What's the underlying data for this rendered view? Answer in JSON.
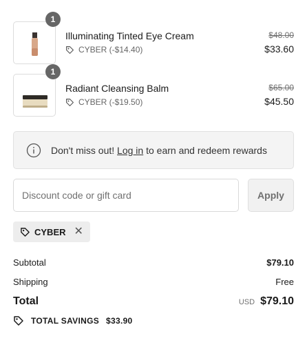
{
  "items": [
    {
      "quantity": "1",
      "name": "Illuminating Tinted Eye Cream",
      "discount": "CYBER (-$14.40)",
      "original_price": "$48.00",
      "price": "$33.60",
      "image": "bottle-thumbnail"
    },
    {
      "quantity": "1",
      "name": "Radiant Cleansing Balm",
      "discount": "CYBER (-$19.50)",
      "original_price": "$65.00",
      "price": "$45.50",
      "image": "jar-thumbnail"
    }
  ],
  "rewards_notice": {
    "before": "Don't miss out! ",
    "link": "Log in",
    "after": " to earn and redeem rewards"
  },
  "discount_field": {
    "placeholder": "Discount code or gift card",
    "value": ""
  },
  "apply_label": "Apply",
  "applied_code": "CYBER",
  "summary": {
    "subtotal_label": "Subtotal",
    "subtotal_value": "$79.10",
    "shipping_label": "Shipping",
    "shipping_value": "Free",
    "total_label": "Total",
    "currency": "USD",
    "total_value": "$79.10",
    "savings_label": "TOTAL SAVINGS",
    "savings_value": "$33.90"
  },
  "colors": {
    "badge": "#666666",
    "panel": "#f4f4f4",
    "apply_button": "#f1f1f1",
    "tag": "#ededed"
  }
}
